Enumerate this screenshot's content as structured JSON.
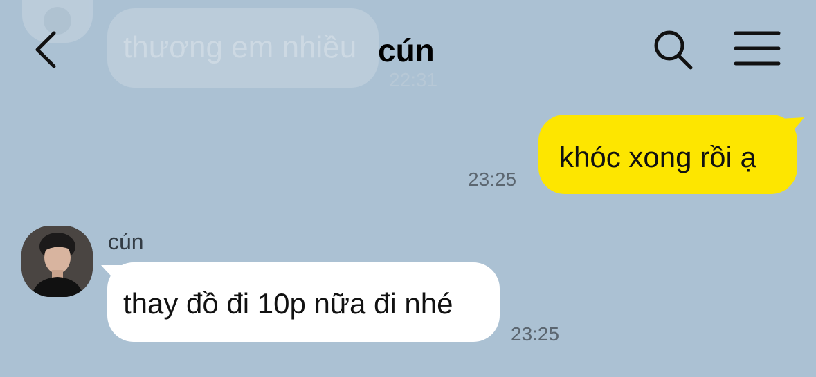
{
  "header": {
    "title": "cún",
    "back_icon": "chevron-left-icon",
    "search_icon": "search-icon",
    "menu_icon": "hamburger-menu-icon"
  },
  "previous_message": {
    "text": "thương em nhiều",
    "time": "22:31"
  },
  "messages": [
    {
      "direction": "outgoing",
      "text": "khóc xong rồi ạ",
      "time": "23:25",
      "bubble_color": "#fde600"
    },
    {
      "direction": "incoming",
      "sender": "cún",
      "text": "thay đồ đi 10p nữa đi nhé",
      "time": "23:25",
      "bubble_color": "#ffffff"
    }
  ],
  "colors": {
    "background": "#abc1d3",
    "outgoing_bubble": "#fde600",
    "incoming_bubble": "#ffffff"
  }
}
